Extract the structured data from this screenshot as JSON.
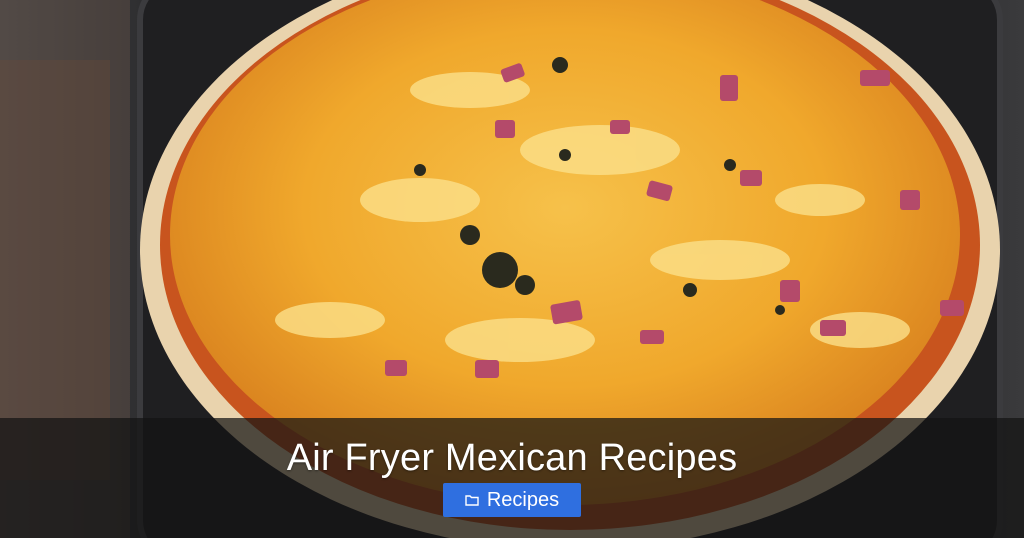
{
  "banner": {
    "title": "Air Fryer Mexican Recipes",
    "category_label": "Recipes",
    "category_icon": "folder-icon"
  },
  "photo": {
    "subject": "cheesy enchilada-style tortilla in an air fryer basket"
  },
  "colors": {
    "overlay": "#141414",
    "badge": "#2f6fe0",
    "text": "#ffffff"
  }
}
